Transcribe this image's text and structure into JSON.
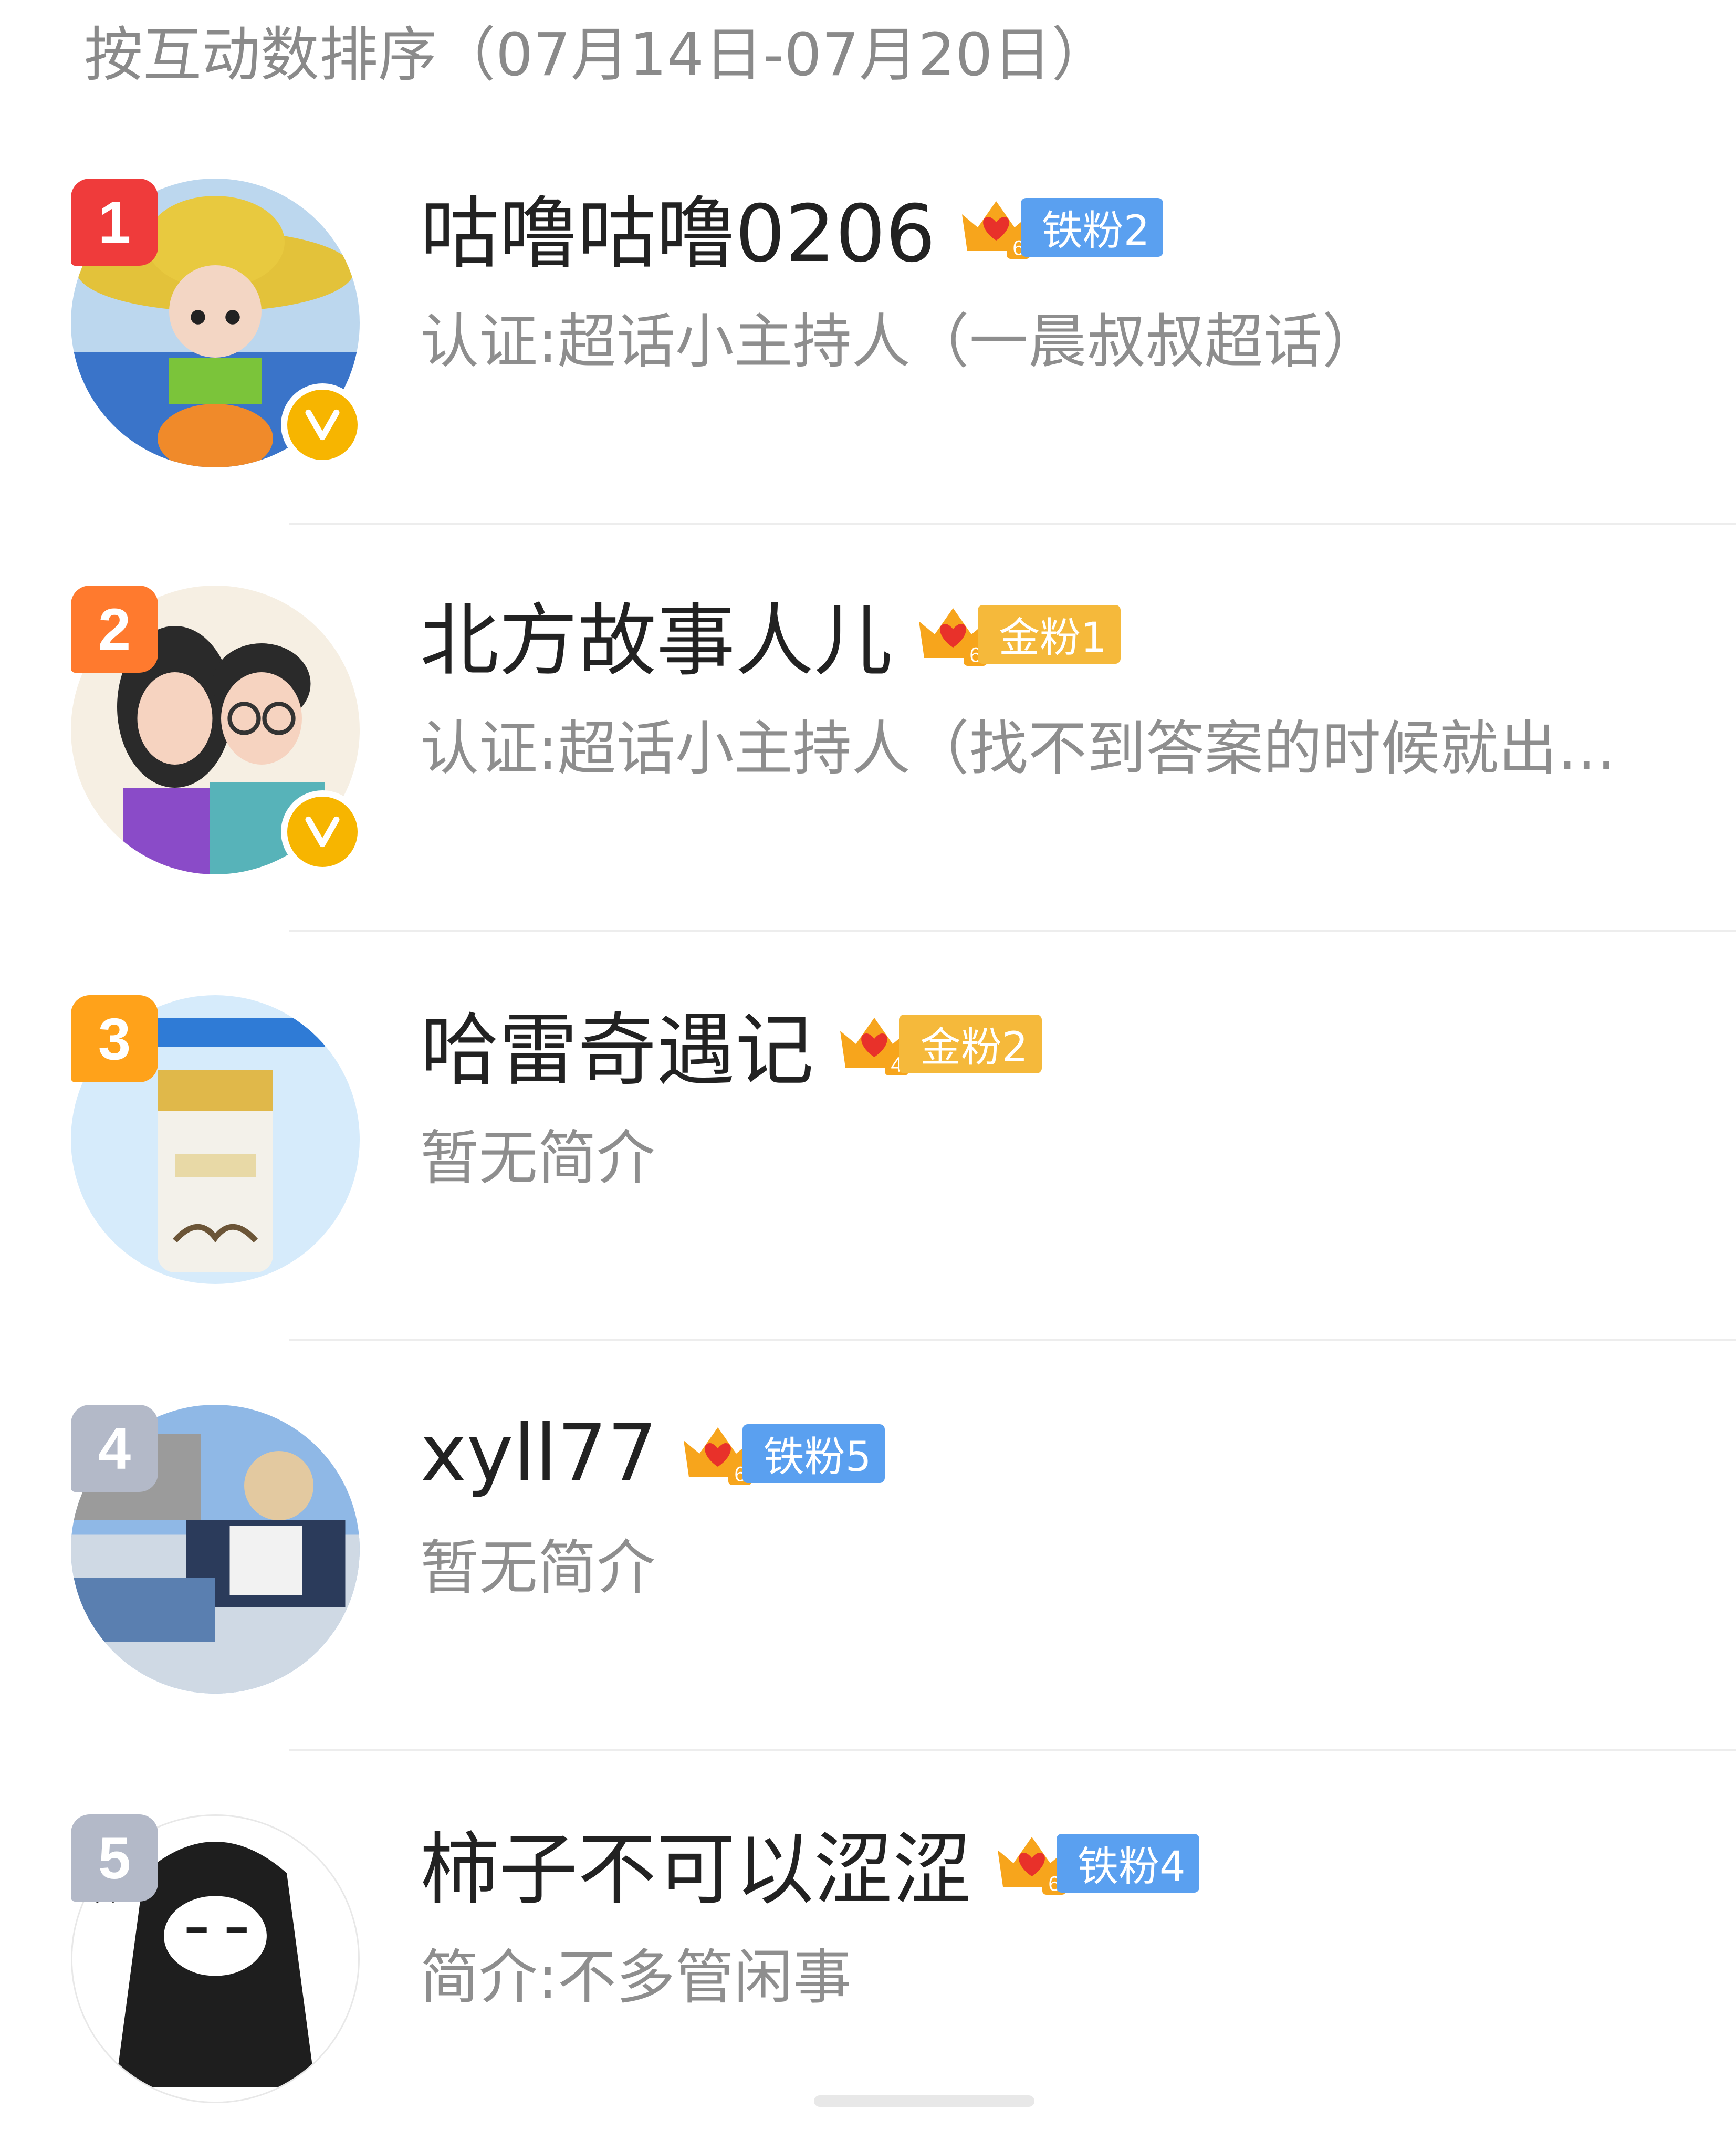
{
  "header": {
    "title": "按互动数排序（07月14日-07月20日）"
  },
  "fans": [
    {
      "rank": "1",
      "name": "咕噜咕噜0206",
      "badge_level": "6",
      "badge_type": "iron",
      "badge_label": "铁粉2",
      "bio": "认证:超话小主持人（一晨叔叔超话）",
      "verified": true,
      "rank_color": "#ef3b3b"
    },
    {
      "rank": "2",
      "name": "北方故事人儿",
      "badge_level": "6",
      "badge_type": "gold",
      "badge_label": "金粉1",
      "bio": "认证:超话小主持人（找不到答案的时候就出…",
      "verified": true,
      "rank_color": "#ff7a2e"
    },
    {
      "rank": "3",
      "name": "哈雷奇遇记",
      "badge_level": "4",
      "badge_type": "gold",
      "badge_label": "金粉2",
      "bio": "暂无简介",
      "verified": false,
      "rank_color": "#ffa21a"
    },
    {
      "rank": "4",
      "name": "xyll77",
      "badge_level": "6",
      "badge_type": "iron",
      "badge_label": "铁粉5",
      "bio": "暂无简介",
      "verified": false,
      "rank_color": "#b3b9c8"
    },
    {
      "rank": "5",
      "name": "柿子不可以涩涩",
      "badge_level": "6",
      "badge_type": "iron",
      "badge_label": "铁粉4",
      "bio": "简介:不多管闲事",
      "verified": false,
      "rank_color": "#b3b9c8"
    }
  ],
  "icons": {
    "verified": "verified-v-icon",
    "badge": "crown-heart-icon"
  }
}
